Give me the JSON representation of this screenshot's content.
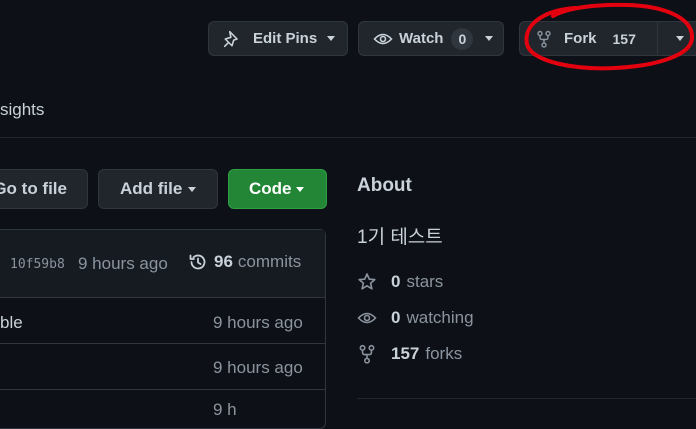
{
  "header": {
    "edit_pins": "Edit Pins",
    "watch_label": "Watch",
    "watch_count": "0",
    "fork_label": "Fork",
    "fork_count": "157"
  },
  "nav": {
    "insights_fragment": "sights"
  },
  "toolbar": {
    "go_to_file": "Go to file",
    "add_file": "Add file",
    "code": "Code"
  },
  "commit_bar": {
    "sha": "10f59b8",
    "time": "9 hours ago",
    "commit_count": "96",
    "commits_label": "commits"
  },
  "files": [
    {
      "name": "ble",
      "time": "9 hours ago"
    },
    {
      "name": "",
      "time": "9 hours ago"
    },
    {
      "name": "",
      "time": "9 h"
    }
  ],
  "about": {
    "heading": "About",
    "description": "1기 테스트",
    "stars_count": "0",
    "stars_label": "stars",
    "watching_count": "0",
    "watching_label": "watching",
    "forks_count": "157",
    "forks_label": "forks"
  },
  "colors": {
    "background": "#0d1117",
    "button_bg": "#21262d",
    "border": "#30363d",
    "primary_green": "#238636",
    "annotation_red": "#e3000f"
  },
  "icons": {
    "pin": "pin-icon",
    "eye": "eye-icon",
    "fork": "fork-icon",
    "history": "history-icon",
    "star": "star-icon"
  }
}
